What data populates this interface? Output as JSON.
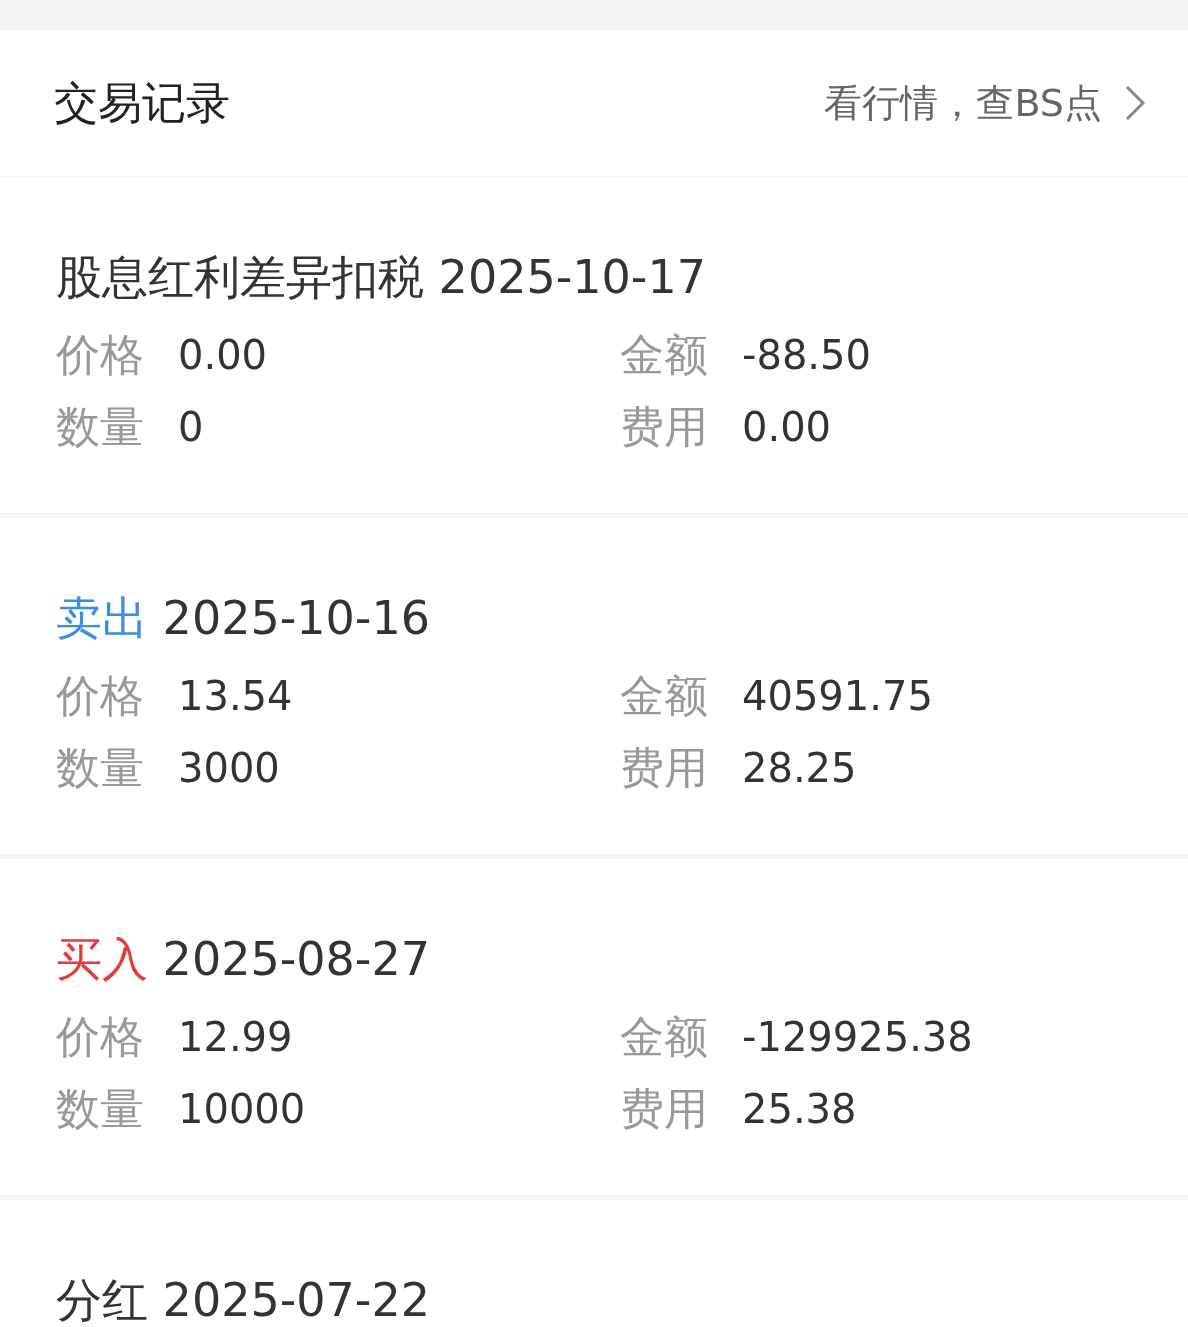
{
  "header": {
    "title": "交易记录",
    "link": "看行情，查BS点"
  },
  "records": [
    {
      "kind": "other",
      "type": "股息红利差异扣税",
      "date": "2025-10-17",
      "fields": [
        {
          "label": "价格",
          "value": "0.00"
        },
        {
          "label": "金额",
          "value": "-88.50"
        },
        {
          "label": "数量",
          "value": "0"
        },
        {
          "label": "费用",
          "value": "0.00"
        }
      ]
    },
    {
      "kind": "sell",
      "type": "卖出",
      "date": "2025-10-16",
      "fields": [
        {
          "label": "价格",
          "value": "13.54"
        },
        {
          "label": "金额",
          "value": "40591.75"
        },
        {
          "label": "数量",
          "value": "3000"
        },
        {
          "label": "费用",
          "value": "28.25"
        }
      ]
    },
    {
      "kind": "buy",
      "type": "买入",
      "date": "2025-08-27",
      "fields": [
        {
          "label": "价格",
          "value": "12.99"
        },
        {
          "label": "金额",
          "value": "-129925.38"
        },
        {
          "label": "数量",
          "value": "10000"
        },
        {
          "label": "费用",
          "value": "25.38"
        }
      ]
    },
    {
      "kind": "other",
      "type": "分红",
      "date": "2025-07-22"
    }
  ]
}
